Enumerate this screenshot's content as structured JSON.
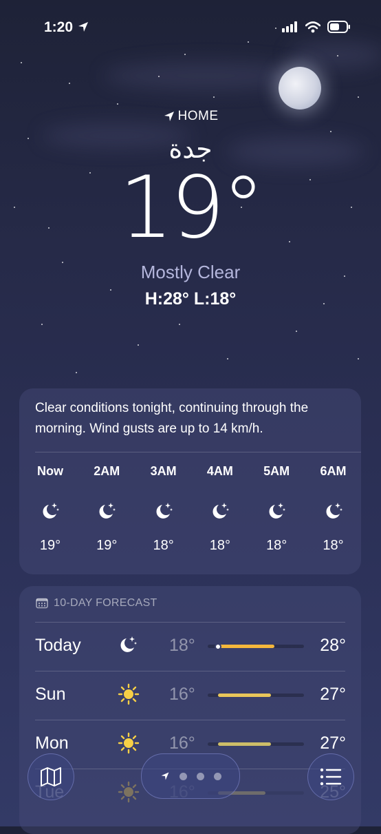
{
  "status": {
    "time": "1:20"
  },
  "location": {
    "label": "HOME",
    "city": "جدة",
    "temperature": "19°",
    "condition": "Mostly Clear",
    "high_low": "H:28°  L:18°"
  },
  "hourly": {
    "summary": "Clear conditions tonight, continuing through the morning. Wind gusts are up to 14 km/h.",
    "hours": [
      {
        "label": "Now",
        "icon": "moon-stars-icon",
        "temp": "19°"
      },
      {
        "label": "2AM",
        "icon": "moon-stars-icon",
        "temp": "19°"
      },
      {
        "label": "3AM",
        "icon": "moon-stars-icon",
        "temp": "18°"
      },
      {
        "label": "4AM",
        "icon": "moon-stars-icon",
        "temp": "18°"
      },
      {
        "label": "5AM",
        "icon": "moon-stars-icon",
        "temp": "18°"
      },
      {
        "label": "6AM",
        "icon": "moon-stars-icon",
        "temp": "18°"
      }
    ]
  },
  "forecast": {
    "title": "10-DAY FORECAST",
    "days": [
      {
        "day": "Today",
        "icon": "moon-stars-icon",
        "low": "18°",
        "high": "28°",
        "bar_start": 0.09,
        "bar_end": 0.69,
        "current_marker": 0.11
      },
      {
        "day": "Sun",
        "icon": "sun-icon",
        "low": "16°",
        "high": "27°",
        "bar_start": 0.11,
        "bar_end": 0.66
      },
      {
        "day": "Mon",
        "icon": "sun-icon",
        "low": "16°",
        "high": "27°",
        "bar_start": 0.11,
        "bar_end": 0.66
      },
      {
        "day": "Tue",
        "icon": "sun-icon",
        "low": "16°",
        "high": "25°",
        "bar_start": 0.11,
        "bar_end": 0.6
      }
    ]
  },
  "colors": {
    "bar_today": "#f5b73b",
    "bar_sun": "#e9c65a",
    "bar_mon": "#cdbd68"
  }
}
